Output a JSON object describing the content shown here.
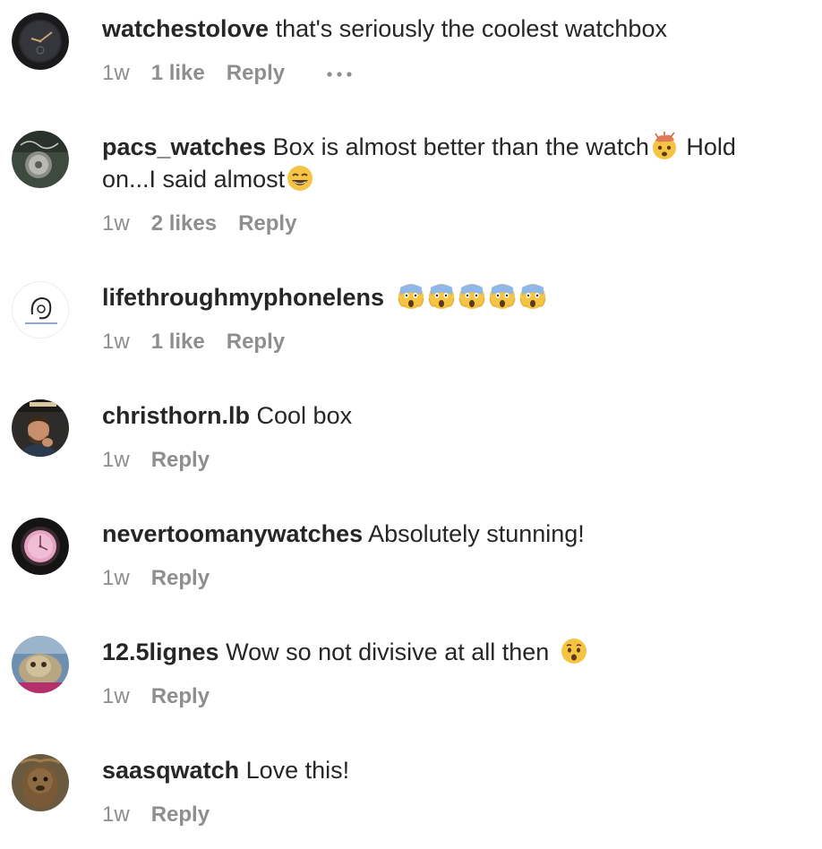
{
  "comments": [
    {
      "username": "watchestolove",
      "text": "that's seriously the coolest watchbox",
      "time": "1w",
      "likes": "1 like",
      "reply": "Reply",
      "more_icon": "ellipsis-icon"
    },
    {
      "username": "pacs_watches",
      "text_a": "Box is almost better than the watch",
      "emoji_a": "exploding-head-emoji",
      "text_b": " Hold on...I said almost",
      "emoji_b": "grinning-smiling-eyes-emoji",
      "time": "1w",
      "likes": "2 likes",
      "reply": "Reply"
    },
    {
      "username": "lifethroughmyphonelens",
      "emojis": [
        "face-screaming-in-fear-emoji",
        "face-screaming-in-fear-emoji",
        "face-screaming-in-fear-emoji",
        "face-screaming-in-fear-emoji",
        "face-screaming-in-fear-emoji"
      ],
      "time": "1w",
      "likes": "1 like",
      "reply": "Reply"
    },
    {
      "username": "christhorn.lb",
      "text": "Cool box",
      "time": "1w",
      "reply": "Reply"
    },
    {
      "username": "nevertoomanywatches",
      "text": "Absolutely stunning!",
      "time": "1w",
      "reply": "Reply"
    },
    {
      "username": "12.5lignes",
      "text": "Wow so not divisive at all then",
      "emoji": "hushed-face-emoji",
      "time": "1w",
      "reply": "Reply"
    },
    {
      "username": "saasqwatch",
      "text": "Love this!",
      "time": "1w",
      "reply": "Reply"
    }
  ],
  "colors": {
    "text": "#262626",
    "secondary": "#8e8e8e",
    "background": "#ffffff"
  }
}
